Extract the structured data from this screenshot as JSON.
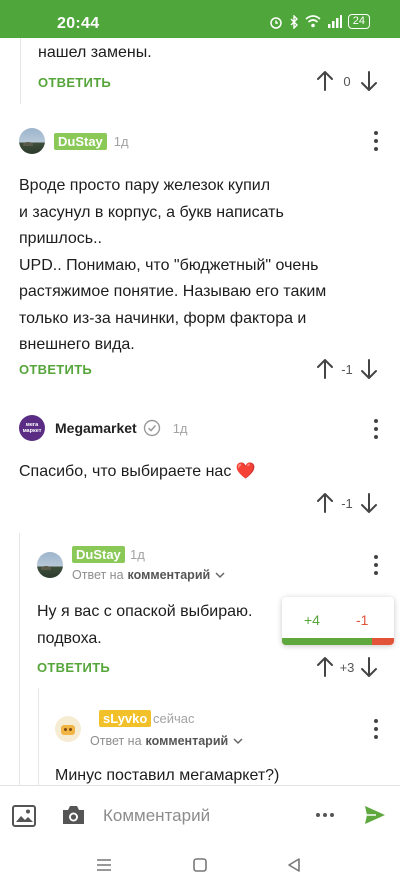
{
  "status_bar": {
    "time": "20:44",
    "battery": "24"
  },
  "top_fragment": {
    "text": "нашел замены.",
    "reply_label": "ОТВЕТИТЬ",
    "score": "0"
  },
  "comments": [
    {
      "author": "DuStay",
      "time_ago": "1д",
      "text": "Вроде просто пару железок купил\nи засунул в корпус, а букв написать\nпришлось..\nUPD.. Понимаю, что \"бюджетный\" очень\nрастяжимое понятие. Называю его таким\nтолько из-за начинки, форм фактора и\nвнешнего вида.",
      "reply_label": "ОТВЕТИТЬ",
      "score": "-1"
    },
    {
      "author": "Megamarket",
      "avatar_text": "мега маркет",
      "time_ago": "1д",
      "text": "Спасибо, что выбираете нас ❤️",
      "score": "-1"
    },
    {
      "author": "DuStay",
      "time_ago": "1д",
      "reply_to_prefix": "Ответ на",
      "reply_to_target": "комментарий",
      "text": "Ну я вас с опаской выбираю.\nподвоха.",
      "reply_label": "ОТВЕТИТЬ",
      "score": "+3"
    },
    {
      "author": "sLyvko",
      "time_ago": "сейчас",
      "reply_to_prefix": "Ответ на",
      "reply_to_target": "комментарий",
      "text": "Минус поставил мегамаркет?)"
    }
  ],
  "vote_popup": {
    "plus": "+4",
    "minus": "-1",
    "positive_fraction": 0.8
  },
  "composer": {
    "placeholder": "Комментарий"
  },
  "colors": {
    "accent_green": "#56a53b",
    "status_bar": "#4fa63a",
    "minus_red": "#e2533a",
    "author_tag_yellow": "#f2c12a",
    "megamarket_purple": "#5b2c84"
  },
  "icons": [
    "alarm-icon",
    "bluetooth-icon",
    "wifi-icon",
    "signal-icon",
    "battery-icon",
    "upvote-arrow-icon",
    "downvote-arrow-icon",
    "more-vertical-icon",
    "verified-icon",
    "heart-icon",
    "chevron-down-icon",
    "image-icon",
    "camera-icon",
    "send-icon",
    "menu-icon",
    "home-square-icon",
    "back-triangle-icon"
  ]
}
